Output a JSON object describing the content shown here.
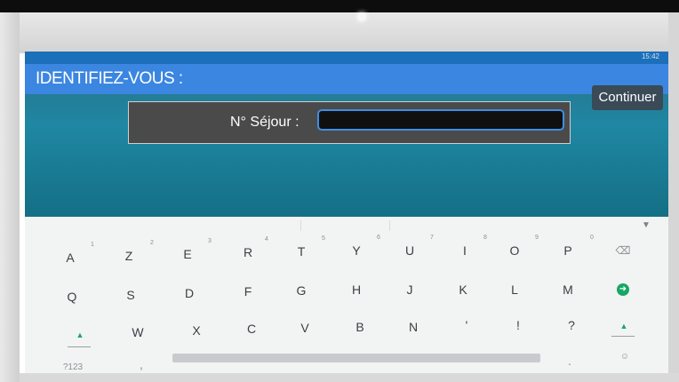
{
  "header": {
    "title": "IDENTIFIEZ-VOUS :",
    "status_time": "15:42"
  },
  "form": {
    "label": "N° Séjour :",
    "value": ""
  },
  "actions": {
    "continue_label": "Continuer"
  },
  "keyboard": {
    "row1": [
      "A",
      "Z",
      "E",
      "R",
      "T",
      "Y",
      "U",
      "I",
      "O",
      "P"
    ],
    "row1_hints": [
      "1",
      "2",
      "3",
      "4",
      "5",
      "6",
      "7",
      "8",
      "9",
      "0"
    ],
    "row2": [
      "Q",
      "S",
      "D",
      "F",
      "G",
      "H",
      "J",
      "K",
      "L",
      "M"
    ],
    "row3": [
      "W",
      "X",
      "C",
      "V",
      "B",
      "N",
      "'",
      "!",
      "?"
    ],
    "symbols_label": "?123",
    "comma_label": ",",
    "period_label": "."
  },
  "icons": [
    "backspace-icon",
    "enter-icon",
    "shift-icon",
    "mic-icon",
    "emoji-icon"
  ],
  "colors": {
    "title_bar": "#3b86e0",
    "input_border": "#3e8fe6",
    "accent_green": "#16a765"
  }
}
